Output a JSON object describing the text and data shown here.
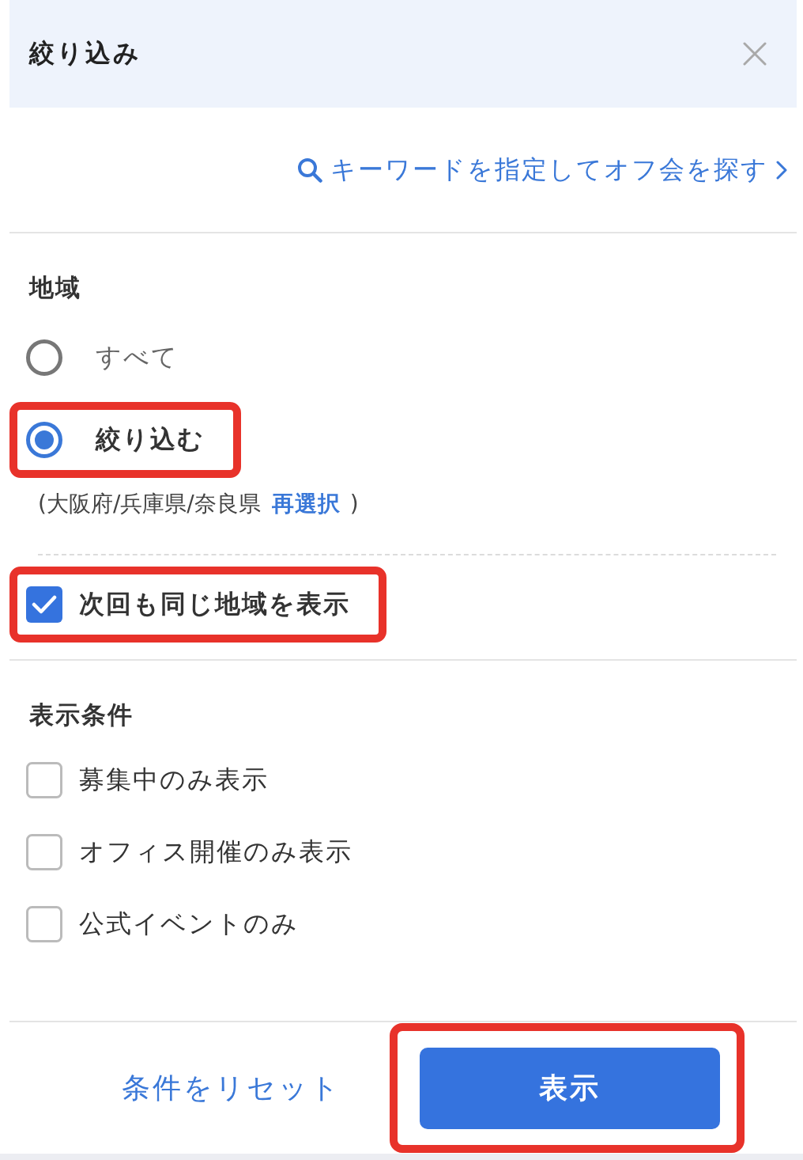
{
  "header": {
    "title": "絞り込み"
  },
  "keyword_search": {
    "label": "キーワードを指定してオフ会を探す"
  },
  "region": {
    "heading": "地域",
    "options": [
      {
        "label": "すべて",
        "selected": false,
        "highlighted": false
      },
      {
        "label": "絞り込む",
        "selected": true,
        "highlighted": true
      }
    ],
    "selection": {
      "text": "(大阪府/兵庫県/奈良県",
      "link": "再選択",
      "closing": ")"
    },
    "remember": {
      "label": "次回も同じ地域を表示",
      "checked": true,
      "highlighted": true
    }
  },
  "display_conditions": {
    "heading": "表示条件",
    "options": [
      {
        "label": "募集中のみ表示",
        "checked": false
      },
      {
        "label": "オフィス開催のみ表示",
        "checked": false
      },
      {
        "label": "公式イベントのみ",
        "checked": false
      }
    ]
  },
  "footer": {
    "reset": "条件をリセット",
    "submit": {
      "label": "表示",
      "highlighted": true
    }
  }
}
